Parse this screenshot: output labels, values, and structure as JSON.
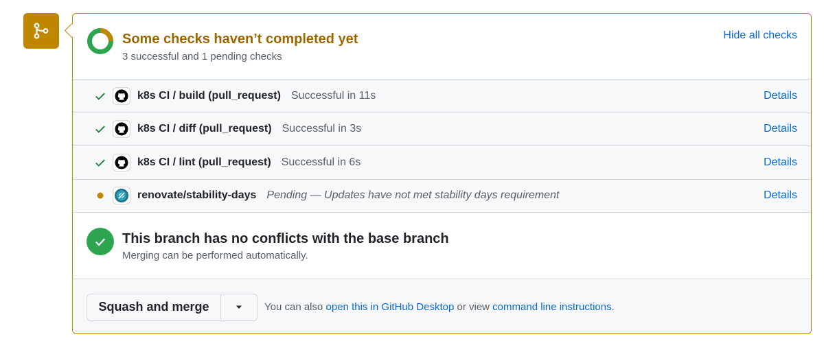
{
  "checks_summary": {
    "title": "Some checks haven’t completed yet",
    "subtitle": "3 successful and 1 pending checks",
    "hide_all_label": "Hide all checks",
    "successful": 3,
    "pending": 1
  },
  "checks": [
    {
      "status": "success",
      "app": "github-actions",
      "name": "k8s CI / build (pull_request)",
      "description": "Successful in 11s",
      "details_label": "Details"
    },
    {
      "status": "success",
      "app": "github-actions",
      "name": "k8s CI / diff (pull_request)",
      "description": "Successful in 3s",
      "details_label": "Details"
    },
    {
      "status": "success",
      "app": "github-actions",
      "name": "k8s CI / lint (pull_request)",
      "description": "Successful in 6s",
      "details_label": "Details"
    },
    {
      "status": "pending",
      "app": "renovate",
      "name": "renovate/stability-days",
      "description": "Pending — Updates have not met stability days requirement",
      "details_label": "Details"
    }
  ],
  "conflicts": {
    "title": "This branch has no conflicts with the base branch",
    "subtitle": "Merging can be performed automatically."
  },
  "merge": {
    "button_label": "Squash and merge",
    "hint_prefix": "You can also ",
    "desktop_link": "open this in GitHub Desktop",
    "hint_middle": " or view ",
    "cli_link": "command line instructions",
    "hint_suffix": "."
  },
  "colors": {
    "warning": "#bf8700",
    "warning_text": "#9a6700",
    "success": "#2da44e",
    "link": "#0969da"
  },
  "icons": {
    "badge": "git-branch-icon",
    "success": "check-icon",
    "pending": "dot-icon",
    "github_app": "github-mark-icon",
    "renovate_app": "renovate-icon",
    "caret": "triangle-down-icon"
  }
}
